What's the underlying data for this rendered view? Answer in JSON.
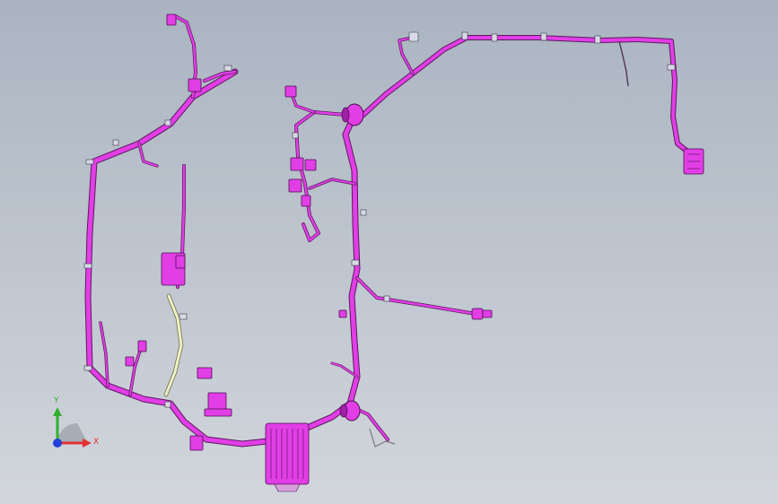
{
  "viewport": {
    "background_top": "#aab4c1",
    "background_bottom": "#d2d6dc"
  },
  "harness": {
    "wire_color": "#e23ee6",
    "outline_color": "#5a1a5e",
    "alt_wire_color": "#eef0c6"
  },
  "triad": {
    "x_label": "X",
    "y_label": "Y",
    "x_color": "#e23030",
    "y_color": "#30b030",
    "z_color": "#2040d8"
  }
}
